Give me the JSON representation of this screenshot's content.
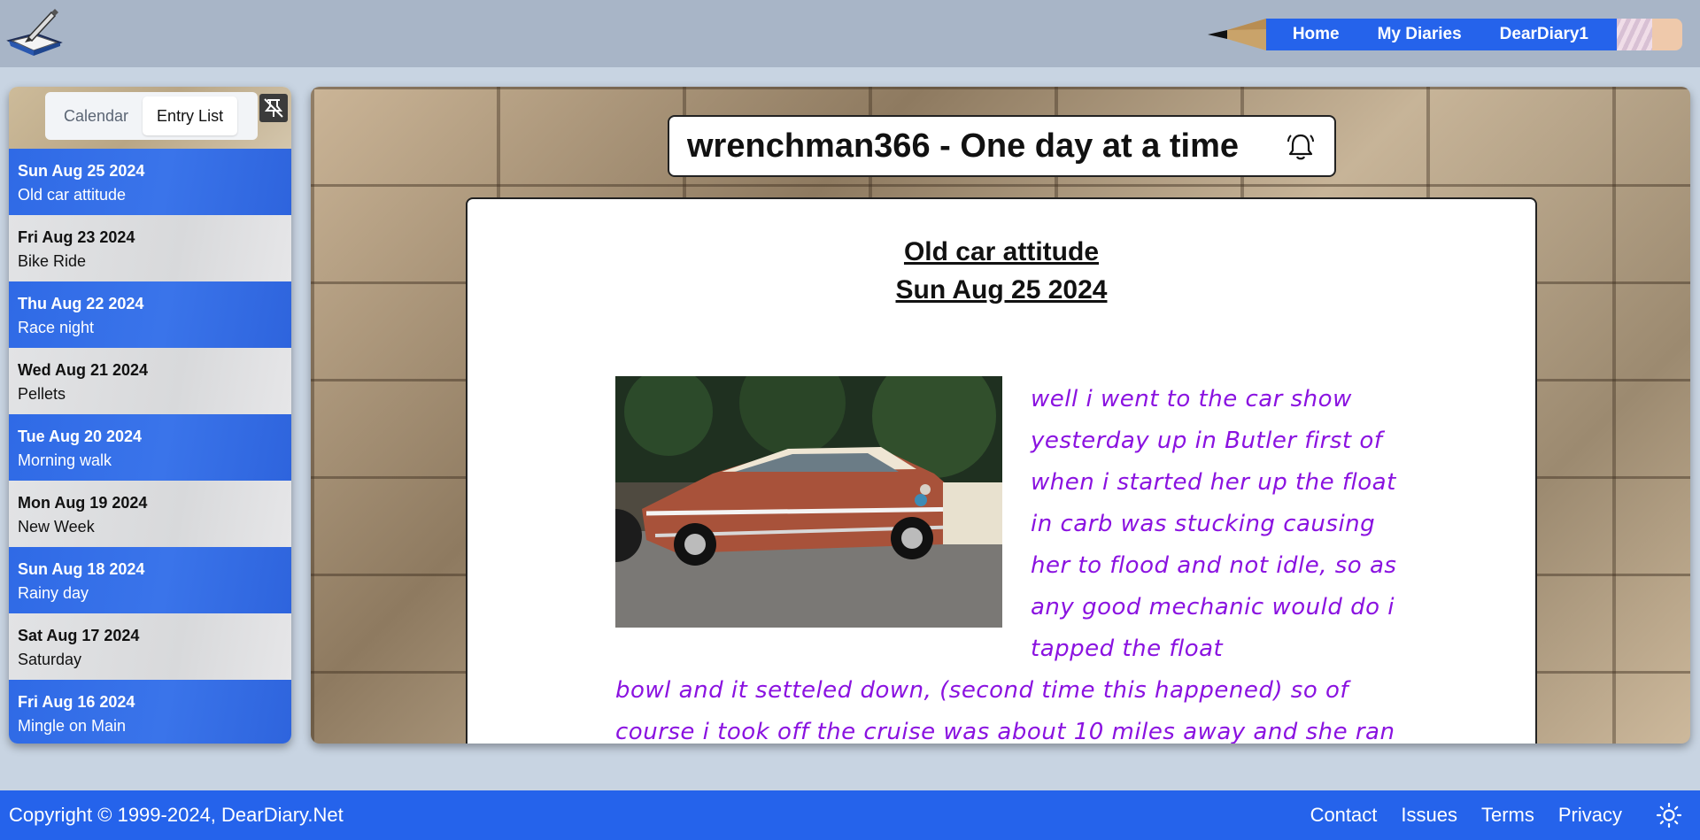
{
  "nav": {
    "home": "Home",
    "my_diaries": "My Diaries",
    "user": "DearDiary1"
  },
  "sidebar": {
    "tabs": [
      "Calendar",
      "Entry List"
    ],
    "entries": [
      {
        "date": "Sun Aug 25 2024",
        "title": "Old car attitude"
      },
      {
        "date": "Fri Aug 23 2024",
        "title": "Bike Ride"
      },
      {
        "date": "Thu Aug 22 2024",
        "title": "Race night"
      },
      {
        "date": "Wed Aug 21 2024",
        "title": "Pellets"
      },
      {
        "date": "Tue Aug 20 2024",
        "title": "Morning walk"
      },
      {
        "date": "Mon Aug 19 2024",
        "title": "New Week"
      },
      {
        "date": "Sun Aug 18 2024",
        "title": "Rainy day"
      },
      {
        "date": "Sat Aug 17 2024",
        "title": "Saturday"
      },
      {
        "date": "Fri Aug 16 2024",
        "title": "Mingle on Main"
      }
    ]
  },
  "diary": {
    "title": "wrenchman366 - One day at a time"
  },
  "entry": {
    "title": "Old car attitude",
    "date": "Sun Aug 25 2024",
    "body_column": "well i went to the car show yesterday up in Butler first of when i started her up the float in carb was stucking causing her to flood and not idle, so as any good mechanic would do i tapped the float",
    "body_full": "bowl and it setteled down, (second time this happened) so of course i took off the cruise was about 10 miles away and she ran"
  },
  "footer": {
    "copyright": "Copyright © 1999-2024, DearDiary.Net",
    "links": [
      "Contact",
      "Issues",
      "Terms",
      "Privacy"
    ]
  },
  "colors": {
    "accent": "#2563eb",
    "entry_text": "#8a12e0"
  }
}
